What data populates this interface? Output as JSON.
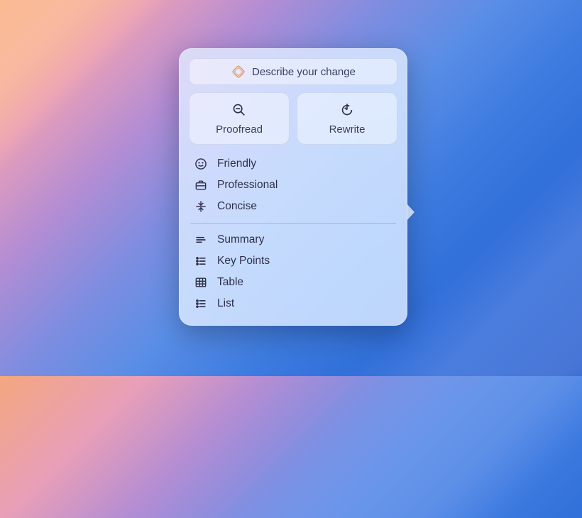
{
  "popover": {
    "describe_label": "Describe your change",
    "proofread_label": "Proofread",
    "rewrite_label": "Rewrite",
    "tone_items": [
      {
        "icon": "smile-icon",
        "label": "Friendly"
      },
      {
        "icon": "briefcase-icon",
        "label": "Professional"
      },
      {
        "icon": "concise-icon",
        "label": "Concise"
      }
    ],
    "format_items": [
      {
        "icon": "summary-icon",
        "label": "Summary"
      },
      {
        "icon": "keypoints-icon",
        "label": "Key Points"
      },
      {
        "icon": "table-icon",
        "label": "Table"
      },
      {
        "icon": "list-icon",
        "label": "List"
      }
    ]
  }
}
